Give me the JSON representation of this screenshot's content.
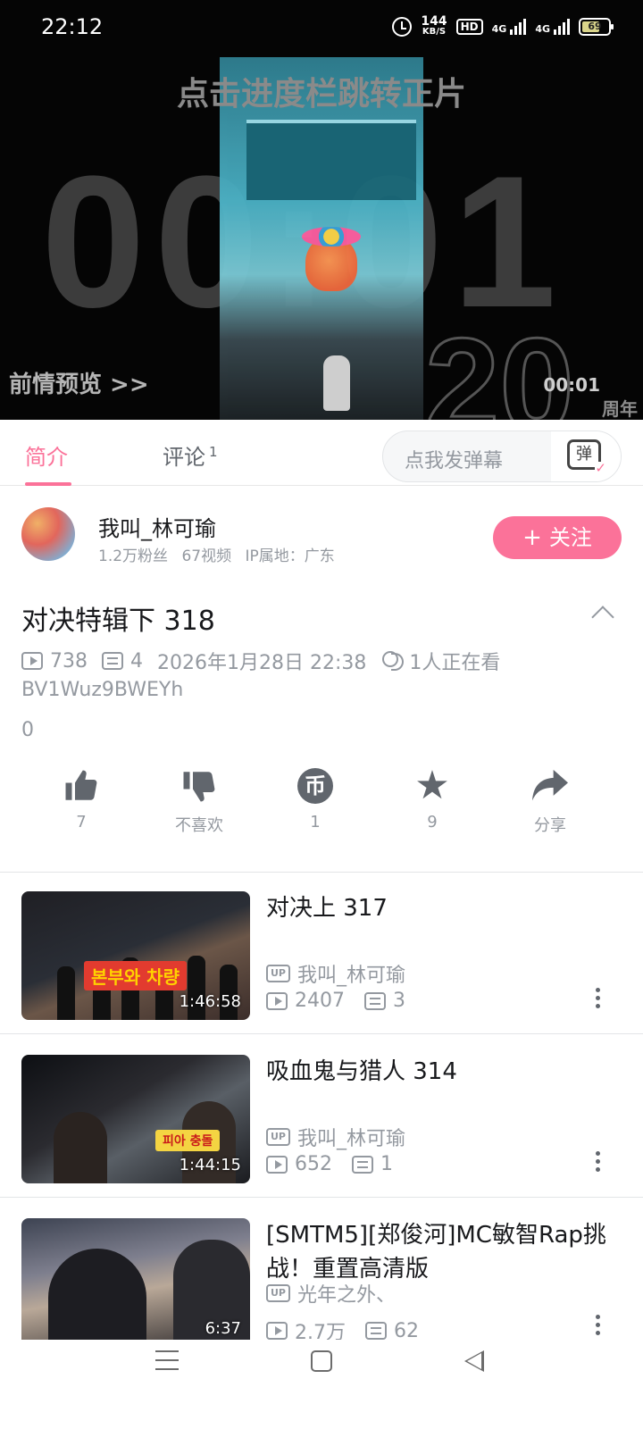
{
  "status_bar": {
    "time": "22:12",
    "net_speed": "144",
    "net_speed_unit": "KB/S",
    "hd": "HD",
    "sim1": "4G",
    "sim2": "4G",
    "battery": "69",
    "battery_level": 0.69
  },
  "player": {
    "overlay_title": "点击进度栏跳转正片",
    "counter": "00:01",
    "anniversary_number": "20",
    "anniversary_label": "周年",
    "preview_link": "前情预览 >>",
    "time": "00:01"
  },
  "tabs": {
    "intro": "简介",
    "comments": "评论",
    "comments_count": "1",
    "danmaku_placeholder": "点我发弹幕",
    "danmaku_icon_char": "弹"
  },
  "uploader": {
    "name": "我叫_林可瑜",
    "stats": "1.2万粉丝 67视频 IP属地：广东",
    "follow_label": "关注",
    "follow_plus": "+"
  },
  "video": {
    "title": "对决特辑下 318",
    "views": "738",
    "danmaku": "4",
    "date": "2026年1月28日 22:38",
    "watching": "1人正在看",
    "bvid": "BV1Wuz9BWEYh",
    "description": "0"
  },
  "actions": {
    "like": "7",
    "dislike": "不喜欢",
    "coin": "1",
    "coin_char": "币",
    "favorite": "9",
    "share": "分享"
  },
  "recommendations": [
    {
      "title": "对决上 317",
      "uploader": "我叫_林可瑜",
      "views": "2407",
      "danmaku": "3",
      "duration": "1:46:58"
    },
    {
      "title": "吸血鬼与猎人 314",
      "uploader": "我叫_林可瑜",
      "views": "652",
      "danmaku": "1",
      "duration": "1:44:15"
    },
    {
      "title": "[SMTM5][郑俊河]MC敏智Rap挑战！重置高清版",
      "uploader": "光年之外、",
      "views": "2.7万",
      "danmaku": "62",
      "duration": "6:37"
    }
  ],
  "up_badge": "UP",
  "colors": {
    "accent": "#fb7299",
    "text_primary": "#18191c",
    "text_secondary": "#9499a0",
    "icon": "#61666d"
  },
  "icons": [
    "alarm-icon",
    "play-icon",
    "danmaku-icon",
    "watchers-icon",
    "like-icon",
    "dislike-icon",
    "coin-icon",
    "star-icon",
    "share-icon",
    "more-icon"
  ]
}
